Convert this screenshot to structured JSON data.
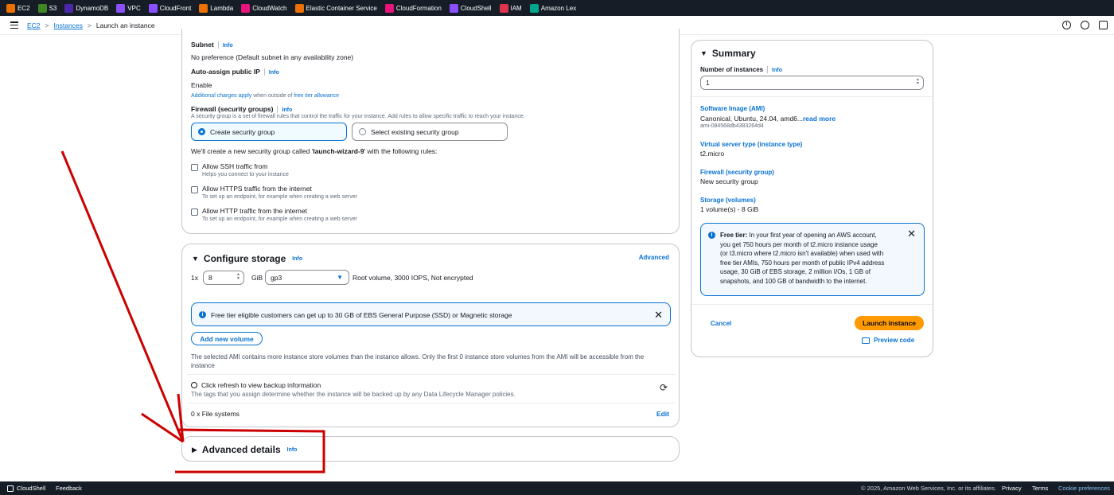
{
  "topbar": {
    "services": [
      {
        "label": "EC2",
        "color": "#ed7100"
      },
      {
        "label": "S3",
        "color": "#3f8624"
      },
      {
        "label": "DynamoDB",
        "color": "#4d27aa"
      },
      {
        "label": "VPC",
        "color": "#8c4fff"
      },
      {
        "label": "CloudFront",
        "color": "#8c4fff"
      },
      {
        "label": "Lambda",
        "color": "#ed7100"
      },
      {
        "label": "CloudWatch",
        "color": "#e7157b"
      },
      {
        "label": "Elastic Container Service",
        "color": "#ed7100"
      },
      {
        "label": "CloudFormation",
        "color": "#e7157b"
      },
      {
        "label": "CloudShell",
        "color": "#8c4fff"
      },
      {
        "label": "IAM",
        "color": "#dd344c"
      },
      {
        "label": "Amazon Lex",
        "color": "#01a88d"
      }
    ]
  },
  "breadcrumb": {
    "ec2": "EC2",
    "instances": "Instances",
    "current": "Launch an instance",
    "sep": ">"
  },
  "network": {
    "info": "Info",
    "subnet_label": "Subnet",
    "subnet_value": "No preference (Default subnet in any availability zone)",
    "public_ip_label": "Auto-assign public IP",
    "public_ip_value": "Enable",
    "charges_link": "Additional charges apply",
    "charges_middle": " when outside of ",
    "charges_link2": "free tier allowance",
    "firewall_label": "Firewall (security groups)",
    "firewall_desc": "A security group is a set of firewall rules that control the traffic for your instance. Add rules to allow specific traffic to reach your instance.",
    "create_sg": "Create security group",
    "select_sg": "Select existing security group",
    "sg_note_pre": "We'll create a new security group called '",
    "sg_note_name": "launch-wizard-9",
    "sg_note_post": "' with the following rules:",
    "rules": [
      {
        "title": "Allow SSH traffic from",
        "desc": "Helps you connect to your instance"
      },
      {
        "title": "Allow HTTPS traffic from the internet",
        "desc": "To set up an endpoint, for example when creating a web server"
      },
      {
        "title": "Allow HTTP traffic from the internet",
        "desc": "To set up an endpoint, for example when creating a web server"
      }
    ]
  },
  "storage": {
    "title": "Configure storage",
    "info": "Info",
    "advanced": "Advanced",
    "count": "1x",
    "size": "8",
    "unit": "GiB",
    "type": "gp3",
    "details": "Root volume,  3000 IOPS,  Not encrypted",
    "alert": "Free tier eligible customers can get up to 30 GB of EBS General Purpose (SSD) or Magnetic storage",
    "add_volume": "Add new volume",
    "ami_note": "The selected AMI contains more instance store volumes than the instance allows. Only the first 0 instance store volumes from the AMI will be accessible from the instance",
    "refresh_title": "Click refresh to view backup information",
    "refresh_desc": "The tags that you assign determine whether the instance will be backed up by any Data Lifecycle Manager policies.",
    "filesystems": "0 x File systems",
    "edit": "Edit"
  },
  "advanced": {
    "title": "Advanced details",
    "info": "Info"
  },
  "summary": {
    "title": "Summary",
    "num_label": "Number of instances",
    "info": "Info",
    "num_value": "1",
    "ami_label": "Software Image (AMI)",
    "ami_value": "Canonical, Ubuntu, 24.04, amd6...",
    "read_more": "read more",
    "ami_id": "ami-084568db4383264d4",
    "type_label": "Virtual server type (instance type)",
    "type_value": "t2.micro",
    "fw_label": "Firewall (security group)",
    "fw_value": "New security group",
    "storage_label": "Storage (volumes)",
    "storage_value": "1 volume(s) - 8 GiB",
    "free_tier_bold": "Free tier:",
    "free_tier_lines": [
      "In your first year of opening an AWS account,",
      "you get 750 hours per month of t2.micro instance usage",
      "(or t3.micro where t2.micro isn't available) when used with",
      "free tier AMIs, 750 hours per month of public IPv4 address",
      "usage, 30 GiB of EBS storage, 2 million I/Os, 1 GB of",
      "snapshots, and 100 GB of bandwidth to the internet."
    ],
    "cancel": "Cancel",
    "launch": "Launch instance",
    "preview": "Preview code"
  },
  "footer": {
    "cloudshell": "CloudShell",
    "feedback": "Feedback",
    "copyright": "© 2025, Amazon Web Services, Inc. or its affiliates.",
    "privacy": "Privacy",
    "terms": "Terms",
    "cookies": "Cookie preferences"
  },
  "colors": {
    "accent": "#0972d3",
    "primary_button": "#ff9900",
    "annotation": "#cc0000",
    "topbar": "#161d26"
  }
}
